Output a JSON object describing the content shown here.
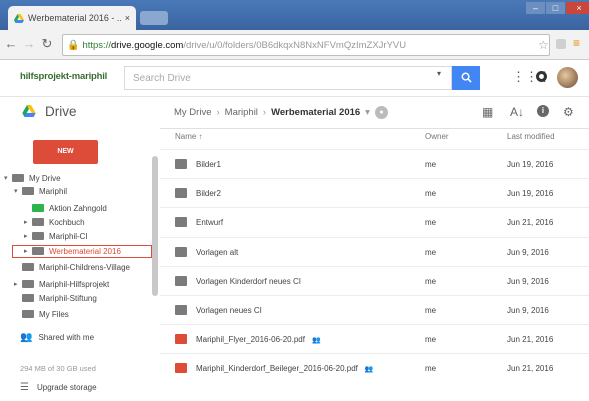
{
  "browser": {
    "tab_title": "Werbematerial 2016 - ...",
    "tab_close": "×",
    "url_https": "https://",
    "url_domain": "drive.google.com",
    "url_path": "/drive/u/0/folders/0B6dkqxN8NxNFVmQzImZXJrYVU"
  },
  "header": {
    "org_name": "hilfsprojekt-mariphil",
    "search_placeholder": "Search Drive",
    "search_button_icon": "search-icon"
  },
  "drive": {
    "title": "Drive",
    "breadcrumb": [
      "My Drive",
      "Mariphil",
      "Werbematerial 2016"
    ]
  },
  "sidebar": {
    "new_label": "NEW",
    "tree": [
      {
        "label": "My Drive",
        "level": 0,
        "expand": "▾"
      },
      {
        "label": "Mariphil",
        "level": 1,
        "expand": "▾"
      },
      {
        "label": "Aktion Zahngold",
        "level": 2,
        "expand": "",
        "color": "green"
      },
      {
        "label": "Kochbuch",
        "level": 2,
        "expand": "▸"
      },
      {
        "label": "Mariphil-CI",
        "level": 2,
        "expand": "▸"
      },
      {
        "label": "Werbematerial 2016",
        "level": 2,
        "expand": "▸",
        "selected": true
      },
      {
        "label": "Mariphil-Childrens-Village",
        "level": 1,
        "expand": ""
      },
      {
        "label": "Mariphil-Hilfsprojekt",
        "level": 1,
        "expand": "▸"
      },
      {
        "label": "Mariphil-Stiftung",
        "level": 1,
        "expand": ""
      },
      {
        "label": "My Files",
        "level": 1,
        "expand": ""
      }
    ],
    "shared_label": "Shared with me",
    "storage_text": "294 MB of 30 GB used",
    "upgrade_label": "Upgrade storage"
  },
  "table": {
    "headers": {
      "name": "Name ↑",
      "owner": "Owner",
      "modified": "Last modified"
    },
    "rows": [
      {
        "name": "Bilder1",
        "owner": "me",
        "modified": "Jun 19, 2016",
        "type": "folder"
      },
      {
        "name": "Bilder2",
        "owner": "me",
        "modified": "Jun 19, 2016",
        "type": "folder"
      },
      {
        "name": "Entwurf",
        "owner": "me",
        "modified": "Jun 21, 2016",
        "type": "folder"
      },
      {
        "name": "Vorlagen alt",
        "owner": "me",
        "modified": "Jun 9, 2016",
        "type": "folder"
      },
      {
        "name": "Vorlagen Kinderdorf neues CI",
        "owner": "me",
        "modified": "Jun 9, 2016",
        "type": "folder"
      },
      {
        "name": "Vorlagen neues CI",
        "owner": "me",
        "modified": "Jun 9, 2016",
        "type": "folder"
      },
      {
        "name": "Mariphil_Flyer_2016-06-20.pdf",
        "owner": "me",
        "modified": "Jun 21, 2016",
        "type": "pdf",
        "shared": true
      },
      {
        "name": "Mariphil_Kinderdorf_Beileger_2016-06-20.pdf",
        "owner": "me",
        "modified": "Jun 21, 2016",
        "type": "pdf",
        "shared": true
      }
    ]
  },
  "colors": {
    "accent_red": "#dd4b39",
    "search_blue": "#4285f4",
    "folder_gray": "#7b7b7b",
    "folder_green": "#2db34a",
    "chrome_blue": "#3d6aa8"
  }
}
